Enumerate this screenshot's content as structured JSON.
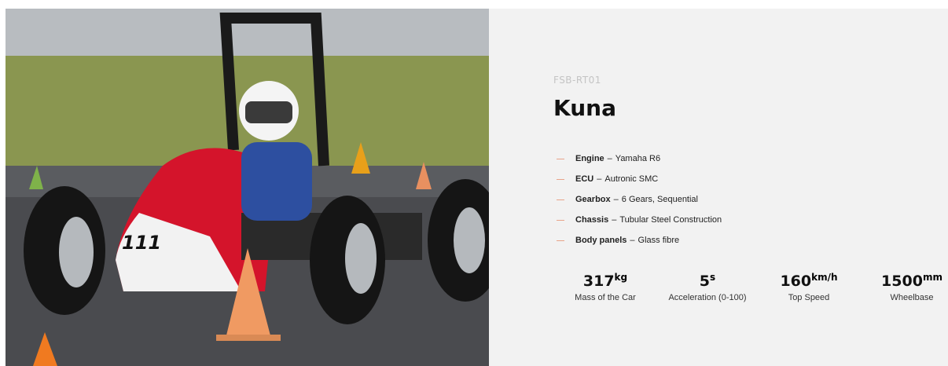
{
  "car": {
    "code": "FSB-RT01",
    "name": "Kuna",
    "photo_number": "111"
  },
  "specs": [
    {
      "name": "Engine",
      "value": "Yamaha R6"
    },
    {
      "name": "ECU",
      "value": "Autronic SMC"
    },
    {
      "name": "Gearbox",
      "value": "6 Gears, Sequential"
    },
    {
      "name": "Chassis",
      "value": "Tubular Steel Construction"
    },
    {
      "name": "Body panels",
      "value": "Glass fibre"
    }
  ],
  "spec_separator": "–",
  "stats": [
    {
      "value": "317",
      "unit": "kg",
      "label": "Mass of the Car"
    },
    {
      "value": "5",
      "unit": "s",
      "label": "Acceleration (0-100)"
    },
    {
      "value": "160",
      "unit": "km/h",
      "label": "Top Speed"
    },
    {
      "value": "1500",
      "unit": "mm",
      "label": "Wheelbase"
    }
  ],
  "colors": {
    "panel": "#f2f2f2",
    "accent_dash": "#e8a48a",
    "body_red": "#d4142b"
  }
}
